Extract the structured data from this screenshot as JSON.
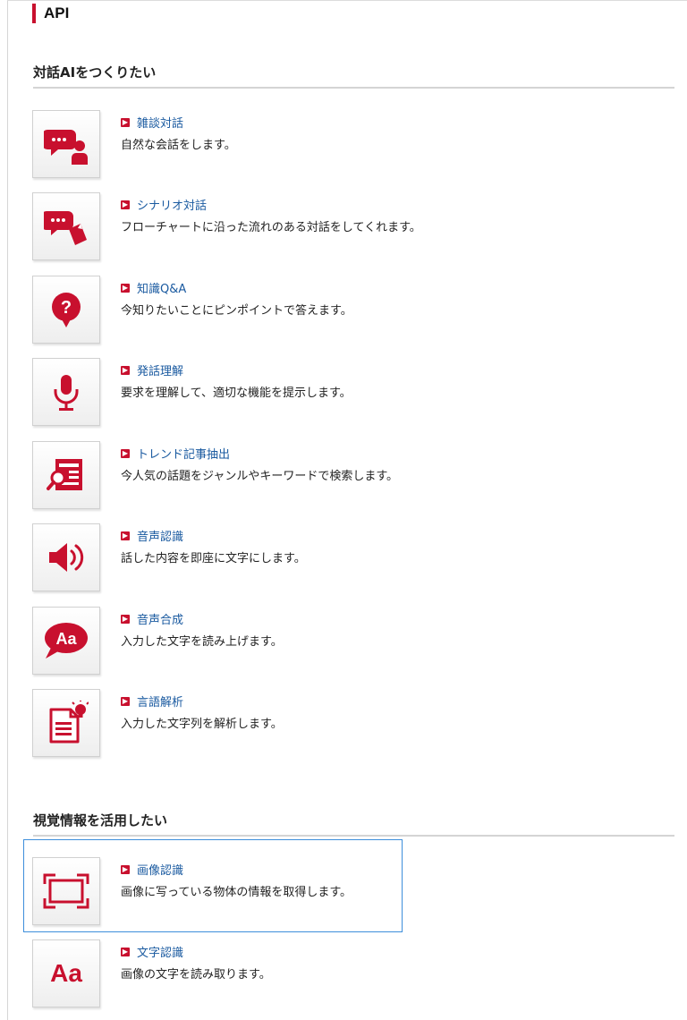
{
  "page": {
    "heading": "API"
  },
  "colors": {
    "accent": "#c8102e",
    "link": "#1a5aa0",
    "focus": "#3d8edb"
  },
  "sections": [
    {
      "title": "対話AIをつくりたい",
      "items": [
        {
          "icon": "chat-person-icon",
          "link": "雑談対話",
          "desc": "自然な会話をします。"
        },
        {
          "icon": "chat-document-icon",
          "link": "シナリオ対話",
          "desc": "フローチャートに沿った流れのある対話をしてくれます。"
        },
        {
          "icon": "question-bubble-icon",
          "link": "知識Q&A",
          "desc": "今知りたいことにピンポイントで答えます。"
        },
        {
          "icon": "microphone-icon",
          "link": "発話理解",
          "desc": "要求を理解して、適切な機能を提示します。"
        },
        {
          "icon": "news-search-icon",
          "link": "トレンド記事抽出",
          "desc": "今人気の話題をジャンルやキーワードで検索します。"
        },
        {
          "icon": "speaker-icon",
          "link": "音声認識",
          "desc": "話した内容を即座に文字にします。"
        },
        {
          "icon": "speech-bubble-aa-icon",
          "link": "音声合成",
          "desc": "入力した文字を読み上げます。"
        },
        {
          "icon": "document-bulb-icon",
          "link": "言語解析",
          "desc": "入力した文字列を解析します。"
        }
      ]
    },
    {
      "title": "視覚情報を活用したい",
      "items": [
        {
          "icon": "image-frame-icon",
          "link": "画像認識",
          "desc": "画像に写っている物体の情報を取得します。"
        },
        {
          "icon": "text-aa-icon",
          "link": "文字認識",
          "desc": "画像の文字を読み取ります。",
          "glyph": "Aa"
        }
      ]
    }
  ]
}
